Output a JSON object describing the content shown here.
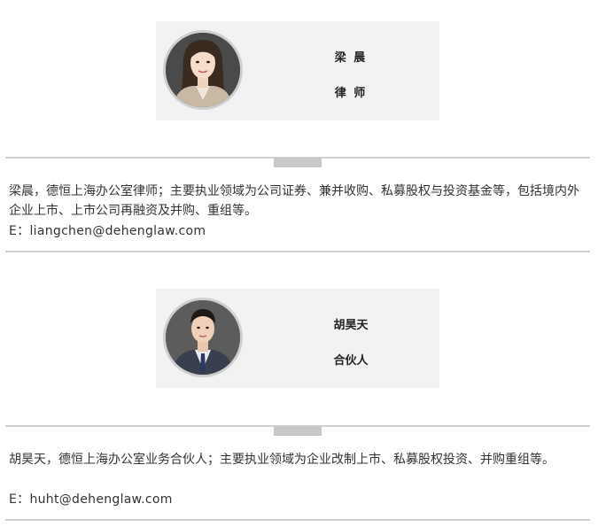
{
  "profiles": [
    {
      "name": "梁 晨",
      "title": "律 师",
      "bio": "梁晨，德恒上海办公室律师；主要执业领域为公司证券、兼并收购、私募股权与投资基金等，包括境内外企业上市、上市公司再融资及并购、重组等。",
      "email": "E：liangchen@dehenglaw.com",
      "avatar_icon": "female-portrait-icon"
    },
    {
      "name": "胡昊天",
      "title": "合伙人",
      "bio": "胡昊天，德恒上海办公室业务合伙人；主要执业领域为企业改制上市、私募股权投资、并购重组等。",
      "email": "E：huht@dehenglaw.com",
      "avatar_icon": "male-portrait-icon"
    }
  ]
}
